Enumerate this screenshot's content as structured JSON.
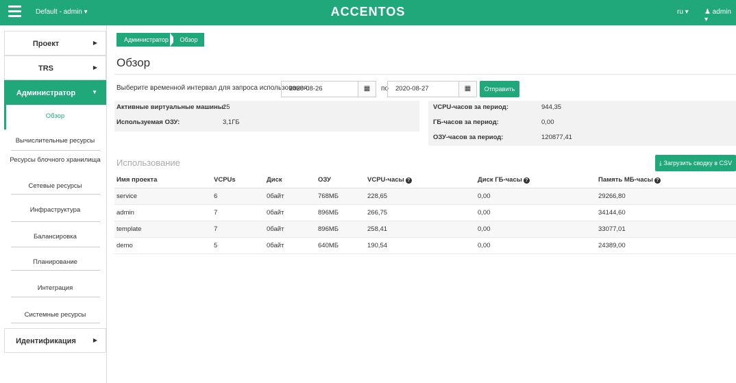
{
  "topbar": {
    "project": "Default - admin ▾",
    "logo": "ACCENTOS",
    "lang": "ru ▾",
    "user": "admin ▾"
  },
  "sidebar": {
    "sections": [
      {
        "label": "Проект",
        "active": false
      },
      {
        "label": "TRS",
        "active": false
      },
      {
        "label": "Администратор",
        "active": true
      },
      {
        "label": "Идентификация",
        "active": false
      }
    ],
    "items": [
      {
        "label": "Обзор"
      },
      {
        "label": "Вычислительные ресурсы"
      },
      {
        "label": "Ресурсы блочного хранилища"
      },
      {
        "label": "Сетевые ресурсы"
      },
      {
        "label": "Инфраструктура"
      },
      {
        "label": "Балансировка"
      },
      {
        "label": "Планирование"
      },
      {
        "label": "Интеграция"
      },
      {
        "label": "Системные ресурсы"
      }
    ]
  },
  "breadcrumb": {
    "root": "Администратор",
    "current": "Обзор"
  },
  "page_title": "Обзор",
  "form": {
    "label": "Выберите временной интервал для запроса использования:",
    "start_date": "2020-08-26",
    "to_label": "по",
    "end_date": "2020-08-27",
    "submit": "Отправить"
  },
  "stats_left": [
    {
      "label": "Активные виртуальные машины:",
      "value": "25"
    },
    {
      "label": "Используемая ОЗУ:",
      "value": "3,1ГБ"
    }
  ],
  "stats_right": [
    {
      "label": "VCPU-часов за период:",
      "value": "944,35"
    },
    {
      "label": "ГБ-часов за период:",
      "value": "0,00"
    },
    {
      "label": "ОЗУ-часов за период:",
      "value": "120877,41"
    }
  ],
  "usage": {
    "heading": "Использование",
    "csv_button": "Загрузить сводку в CSV"
  },
  "table": {
    "columns": [
      "Имя проекта",
      "VCPUs",
      "Диск",
      "ОЗУ",
      "VCPU-часы",
      "Диск ГБ-часы",
      "Память МБ-часы"
    ],
    "rows": [
      [
        "service",
        "6",
        "0байт",
        "768МБ",
        "228,65",
        "0,00",
        "29266,80"
      ],
      [
        "admin",
        "7",
        "0байт",
        "896МБ",
        "266,75",
        "0,00",
        "34144,60"
      ],
      [
        "template",
        "7",
        "0байт",
        "896МБ",
        "258,41",
        "0,00",
        "33077,01"
      ],
      [
        "demo",
        "5",
        "0байт",
        "640МБ",
        "190,54",
        "0,00",
        "24389,00"
      ]
    ]
  },
  "colors": {
    "accent": "#20a87a"
  },
  "icons": {
    "menu": "hamburger-icon",
    "calendar": "calendar-icon",
    "download": "download-icon",
    "help": "question-circle-icon",
    "user": "user-icon"
  }
}
